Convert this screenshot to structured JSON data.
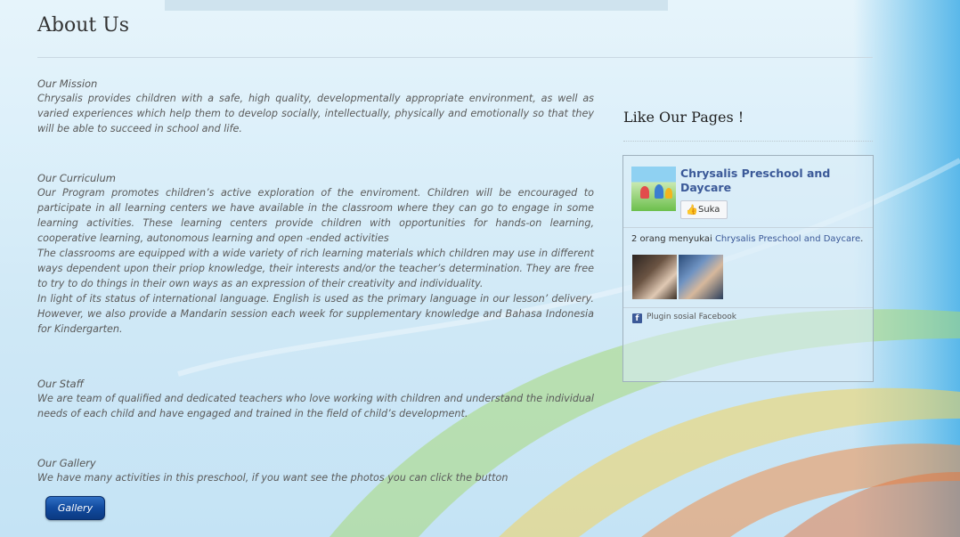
{
  "page": {
    "title": "About Us"
  },
  "sections": [
    {
      "heading": "Our Mission",
      "body": "Chrysalis provides children with a safe, high quality, developmentally appropriate environment, as well as varied experiences which help them to develop socially, intellectually, physically and emotionally so that they will be able to succeed in school and life."
    },
    {
      "heading": "Our Curriculum",
      "body": "Our Program promotes children’s active exploration of the enviroment. Children will be encouraged to participate in all learning centers we have available in the classroom where they can go to engage in some learning activities. These learning centers provide children with opportunities for hands-on learning, cooperative learning, autonomous learning and open -ended activities",
      "body2": "The classrooms are equipped with a wide variety of rich learning materials which children may use in different ways dependent upon their priop knowledge, their interests and/or the teacher’s determination. They are free to try to do things in their own ways as an expression of their creativity and individuality.",
      "body3": "In light of its status of international language. English is used as the primary language in our lesson’ delivery. However, we also provide a Mandarin session each week for supplementary knowledge and Bahasa Indonesia for Kindergarten."
    },
    {
      "heading": "Our Staff",
      "body": "We are team of qualified and dedicated teachers who love working with children and understand the individual needs of each child and have engaged and trained in the field of child’s development."
    },
    {
      "heading": "Our Gallery",
      "body": "We have many activities in this preschool, if you want see the photos you can click the button"
    }
  ],
  "gallery_button": {
    "label": "Gallery"
  },
  "sidebar": {
    "title": "Like Our Pages !",
    "facebook": {
      "page_name": "Chrysalis Preschool and Daycare",
      "like_label": "Suka",
      "count_prefix": "2 orang menyukai ",
      "count_link": "Chrysalis Preschool and Daycare",
      "count_suffix": ".",
      "plugin_label": "Plugin sosial Facebook"
    }
  },
  "colors": {
    "accent": "#3b5998",
    "button": "#114a9e",
    "background": "#d9eef9"
  }
}
